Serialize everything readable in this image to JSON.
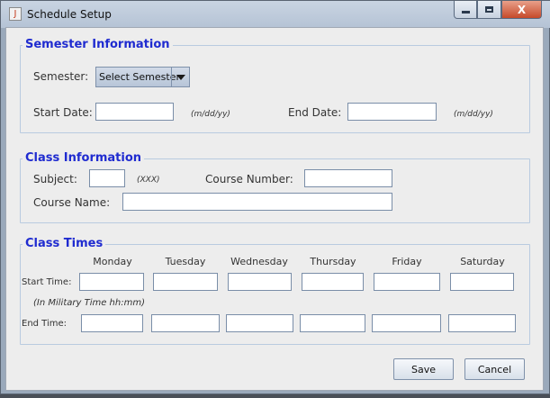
{
  "window": {
    "title": "Schedule Setup",
    "close_glyph": "X",
    "app_icon_glyph": "J"
  },
  "semester": {
    "legend": "Semester Information",
    "semester_label": "Semester:",
    "semester_selected": "Select Semester",
    "start_label": "Start Date:",
    "start_value": "",
    "end_label": "End Date:",
    "end_value": "",
    "date_hint": "(m/dd/yy)"
  },
  "class_info": {
    "legend": "Class Information",
    "subject_label": "Subject:",
    "subject_value": "",
    "subject_hint": "(XXX)",
    "course_number_label": "Course Number:",
    "course_number_value": "",
    "course_name_label": "Course Name:",
    "course_name_value": ""
  },
  "class_times": {
    "legend": "Class Times",
    "days": [
      "Monday",
      "Tuesday",
      "Wednesday",
      "Thursday",
      "Friday",
      "Saturday"
    ],
    "start_time_label": "Start Time:",
    "military_hint": "(In Military Time hh:mm)",
    "end_time_label": "End Time:"
  },
  "actions": {
    "save_label": "Save",
    "cancel_label": "Cancel"
  }
}
